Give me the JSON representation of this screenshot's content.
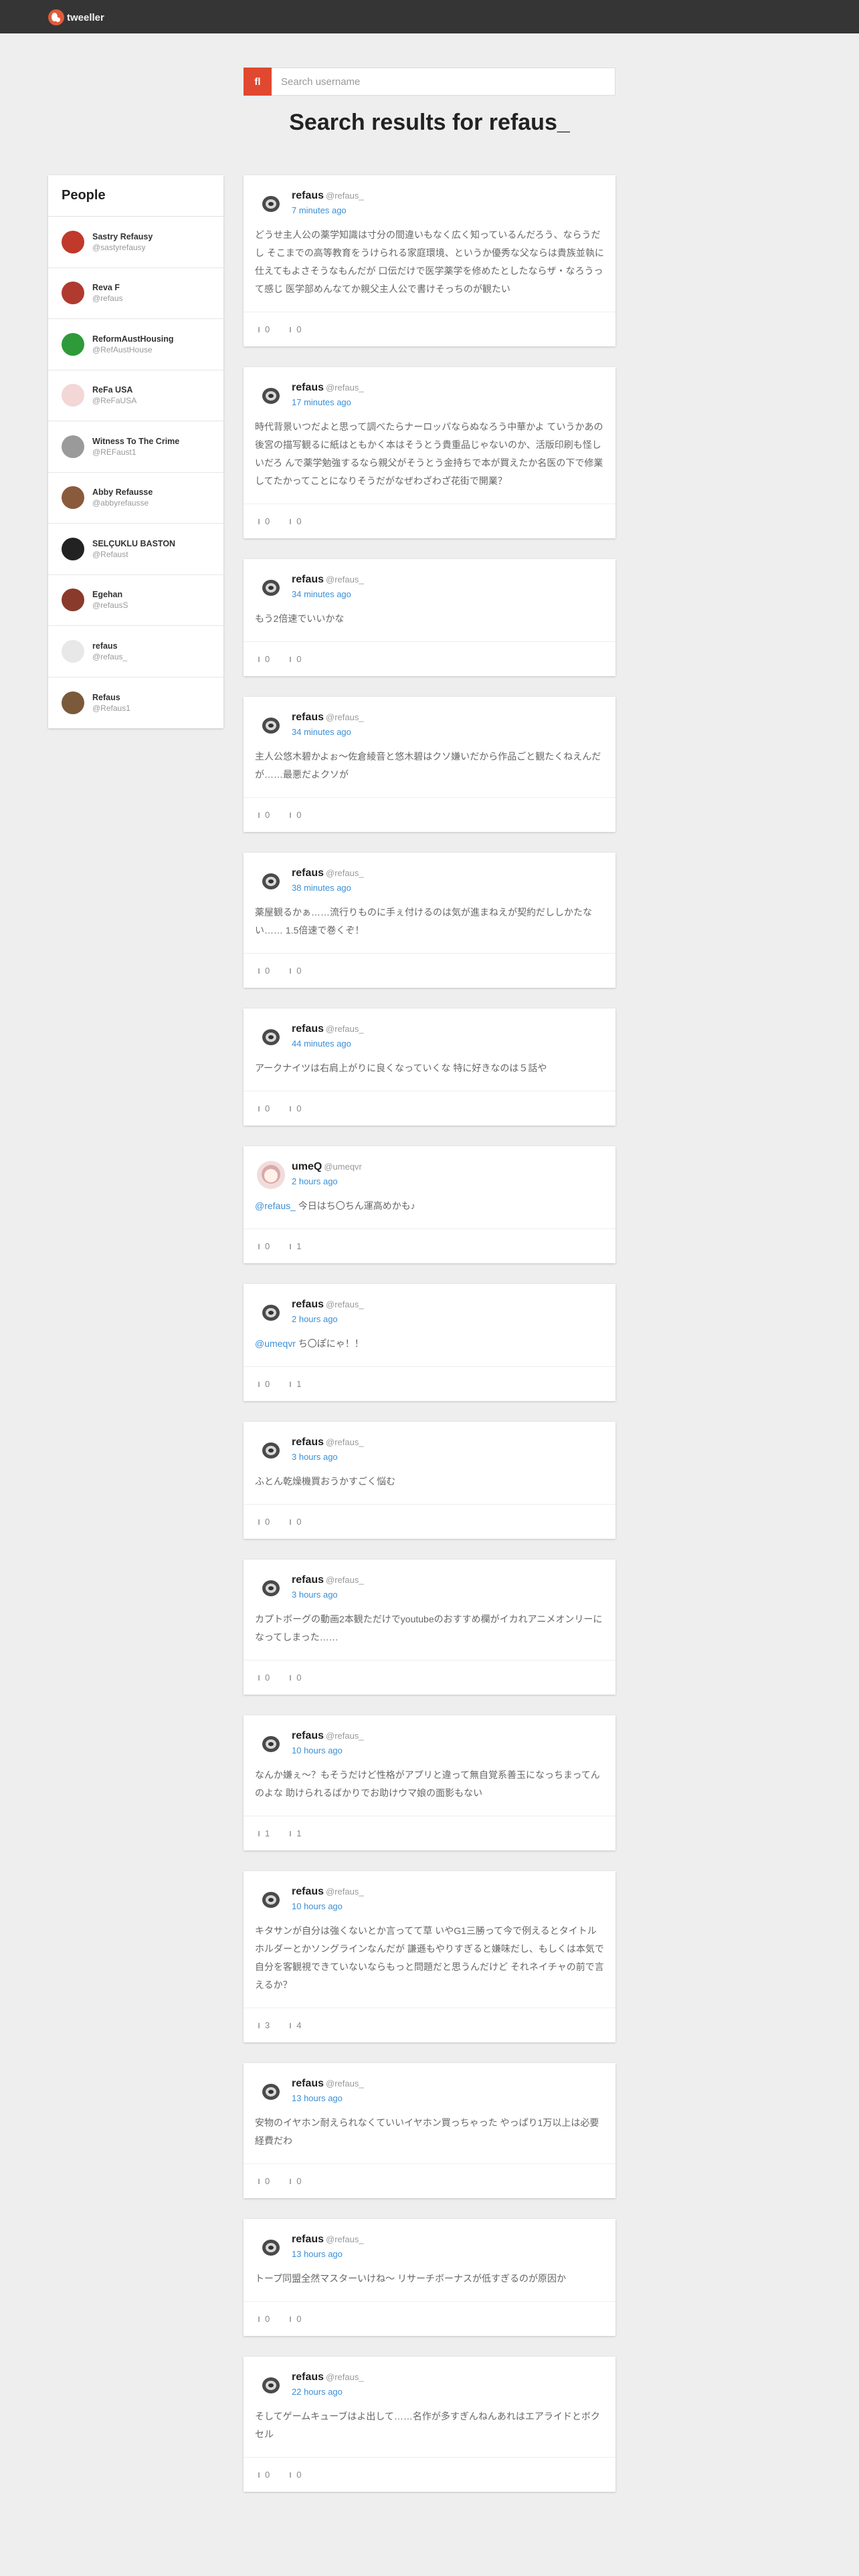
{
  "brand": {
    "name": "tweeller"
  },
  "search": {
    "button_label": "fl",
    "placeholder": "Search username",
    "value": ""
  },
  "results_title": "Search results for refaus_",
  "people": {
    "title": "People",
    "items": [
      {
        "name": "Sastry Refausy",
        "handle": "@sastyrefausy",
        "avatar_color": "#c0392b"
      },
      {
        "name": "Reva F",
        "handle": "@refaus",
        "avatar_color": "#b03a2e"
      },
      {
        "name": "ReformAustHousing",
        "handle": "@RefAustHouse",
        "avatar_color": "#2e9a3a"
      },
      {
        "name": "ReFa USA",
        "handle": "@ReFaUSA",
        "avatar_color": "#f3d6d6"
      },
      {
        "name": "Witness To The Crime",
        "handle": "@REFaust1",
        "avatar_color": "#9a9a9a"
      },
      {
        "name": "Abby Refausse",
        "handle": "@abbyrefausse",
        "avatar_color": "#8a5a3c"
      },
      {
        "name": "SELÇUKLU BASTON",
        "handle": "@Refaust",
        "avatar_color": "#222222"
      },
      {
        "name": "Egehan",
        "handle": "@refausS",
        "avatar_color": "#8a3a2a"
      },
      {
        "name": "refaus",
        "handle": "@refaus_",
        "avatar_color": "#e8e8e8"
      },
      {
        "name": "Refaus",
        "handle": "@Refaus1",
        "avatar_color": "#7a5a3a"
      }
    ]
  },
  "posts": [
    {
      "name": "refaus",
      "handle": "@refaus_",
      "time": "7 minutes ago",
      "mention": "",
      "text": "どうせ主人公の薬学知識は寸分の間違いもなく広く知っているんだろう、ならうだし そこまでの高等教育をうけられる家庭環境、というか優秀な父ならは貴族並執に仕えてもよさそうなもんだが 口伝だけで医学薬学を修めたとしたならザ・なろうって感じ 医学部めんなてか親父主人公で書けそっちのが観たい",
      "likes": "0",
      "retweets": "0",
      "avatar": "cat"
    },
    {
      "name": "refaus",
      "handle": "@refaus_",
      "time": "17 minutes ago",
      "mention": "",
      "text": "時代背景いつだよと思って調べたらナーロッパならぬなろう中華かよ ていうかあの後宮の描写観るに紙はともかく本はそうとう貴重品じゃないのか、活版印刷も怪しいだろ んで薬学勉強するなら親父がそうとう金持ちで本が買えたか名医の下で修業してたかってことになりそうだがなぜわざわざ花街で開業？",
      "likes": "0",
      "retweets": "0",
      "avatar": "cat"
    },
    {
      "name": "refaus",
      "handle": "@refaus_",
      "time": "34 minutes ago",
      "mention": "",
      "text": "もう2倍速でいいかな",
      "likes": "0",
      "retweets": "0",
      "avatar": "cat"
    },
    {
      "name": "refaus",
      "handle": "@refaus_",
      "time": "34 minutes ago",
      "mention": "",
      "text": "主人公悠木碧かよぉ〜佐倉綾音と悠木碧はクソ嫌いだから作品ごと観たくねえんだが……最悪だよクソが",
      "likes": "0",
      "retweets": "0",
      "avatar": "cat"
    },
    {
      "name": "refaus",
      "handle": "@refaus_",
      "time": "38 minutes ago",
      "mention": "",
      "text": "薬屋観るかぁ……流行りものに手ぇ付けるのは気が進まねえが契約だししかたない…… 1.5倍速で巻くぞ！",
      "likes": "0",
      "retweets": "0",
      "avatar": "cat"
    },
    {
      "name": "refaus",
      "handle": "@refaus_",
      "time": "44 minutes ago",
      "mention": "",
      "text": "アークナイツは右肩上がりに良くなっていくな 特に好きなのは５話や",
      "likes": "0",
      "retweets": "0",
      "avatar": "cat"
    },
    {
      "name": "umeQ",
      "handle": "@umeqvr",
      "time": "2 hours ago",
      "mention": "@refaus_",
      "text": " 今日はち〇ちん運高めかも♪",
      "likes": "0",
      "retweets": "1",
      "avatar": "umeq"
    },
    {
      "name": "refaus",
      "handle": "@refaus_",
      "time": "2 hours ago",
      "mention": "@umeqvr",
      "text": " ち〇ぽにゃ！！",
      "likes": "0",
      "retweets": "1",
      "avatar": "cat"
    },
    {
      "name": "refaus",
      "handle": "@refaus_",
      "time": "3 hours ago",
      "mention": "",
      "text": "ふとん乾燥機買おうかすごく悩む",
      "likes": "0",
      "retweets": "0",
      "avatar": "cat"
    },
    {
      "name": "refaus",
      "handle": "@refaus_",
      "time": "3 hours ago",
      "mention": "",
      "text": "カプトボーグの動画2本観ただけでyoutubeのおすすめ欄がイカれアニメオンリーになってしまった……",
      "likes": "0",
      "retweets": "0",
      "avatar": "cat"
    },
    {
      "name": "refaus",
      "handle": "@refaus_",
      "time": "10 hours ago",
      "mention": "",
      "text": "なんか嫌ぇ〜？もそうだけど性格がアプリと違って無自覚系善玉になっちまってんのよな 助けられるばかりでお助けウマ娘の面影もない",
      "likes": "1",
      "retweets": "1",
      "avatar": "cat"
    },
    {
      "name": "refaus",
      "handle": "@refaus_",
      "time": "10 hours ago",
      "mention": "",
      "text": "キタサンが自分は強くないとか言ってて草 いやG1三勝って今で例えるとタイトルホルダーとかソングラインなんだが 謙遜もやりすぎると嫌味だし、もしくは本気で自分を客観視できていないならもっと問題だと思うんだけど それネイチャの前で言えるか？",
      "likes": "3",
      "retweets": "4",
      "avatar": "cat"
    },
    {
      "name": "refaus",
      "handle": "@refaus_",
      "time": "13 hours ago",
      "mention": "",
      "text": "安物のイヤホン耐えられなくていいイヤホン買っちゃった やっぱり1万以上は必要経費だわ",
      "likes": "0",
      "retweets": "0",
      "avatar": "cat"
    },
    {
      "name": "refaus",
      "handle": "@refaus_",
      "time": "13 hours ago",
      "mention": "",
      "text": "トープ同盟全然マスターいけね〜 リサーチボーナスが低すぎるのが原因か",
      "likes": "0",
      "retweets": "0",
      "avatar": "cat"
    },
    {
      "name": "refaus",
      "handle": "@refaus_",
      "time": "22 hours ago",
      "mention": "",
      "text": "そしてゲームキューブはよ出して……名作が多すぎんねんあれはエアライドとボクセル",
      "likes": "0",
      "retweets": "0",
      "avatar": "cat"
    }
  ]
}
